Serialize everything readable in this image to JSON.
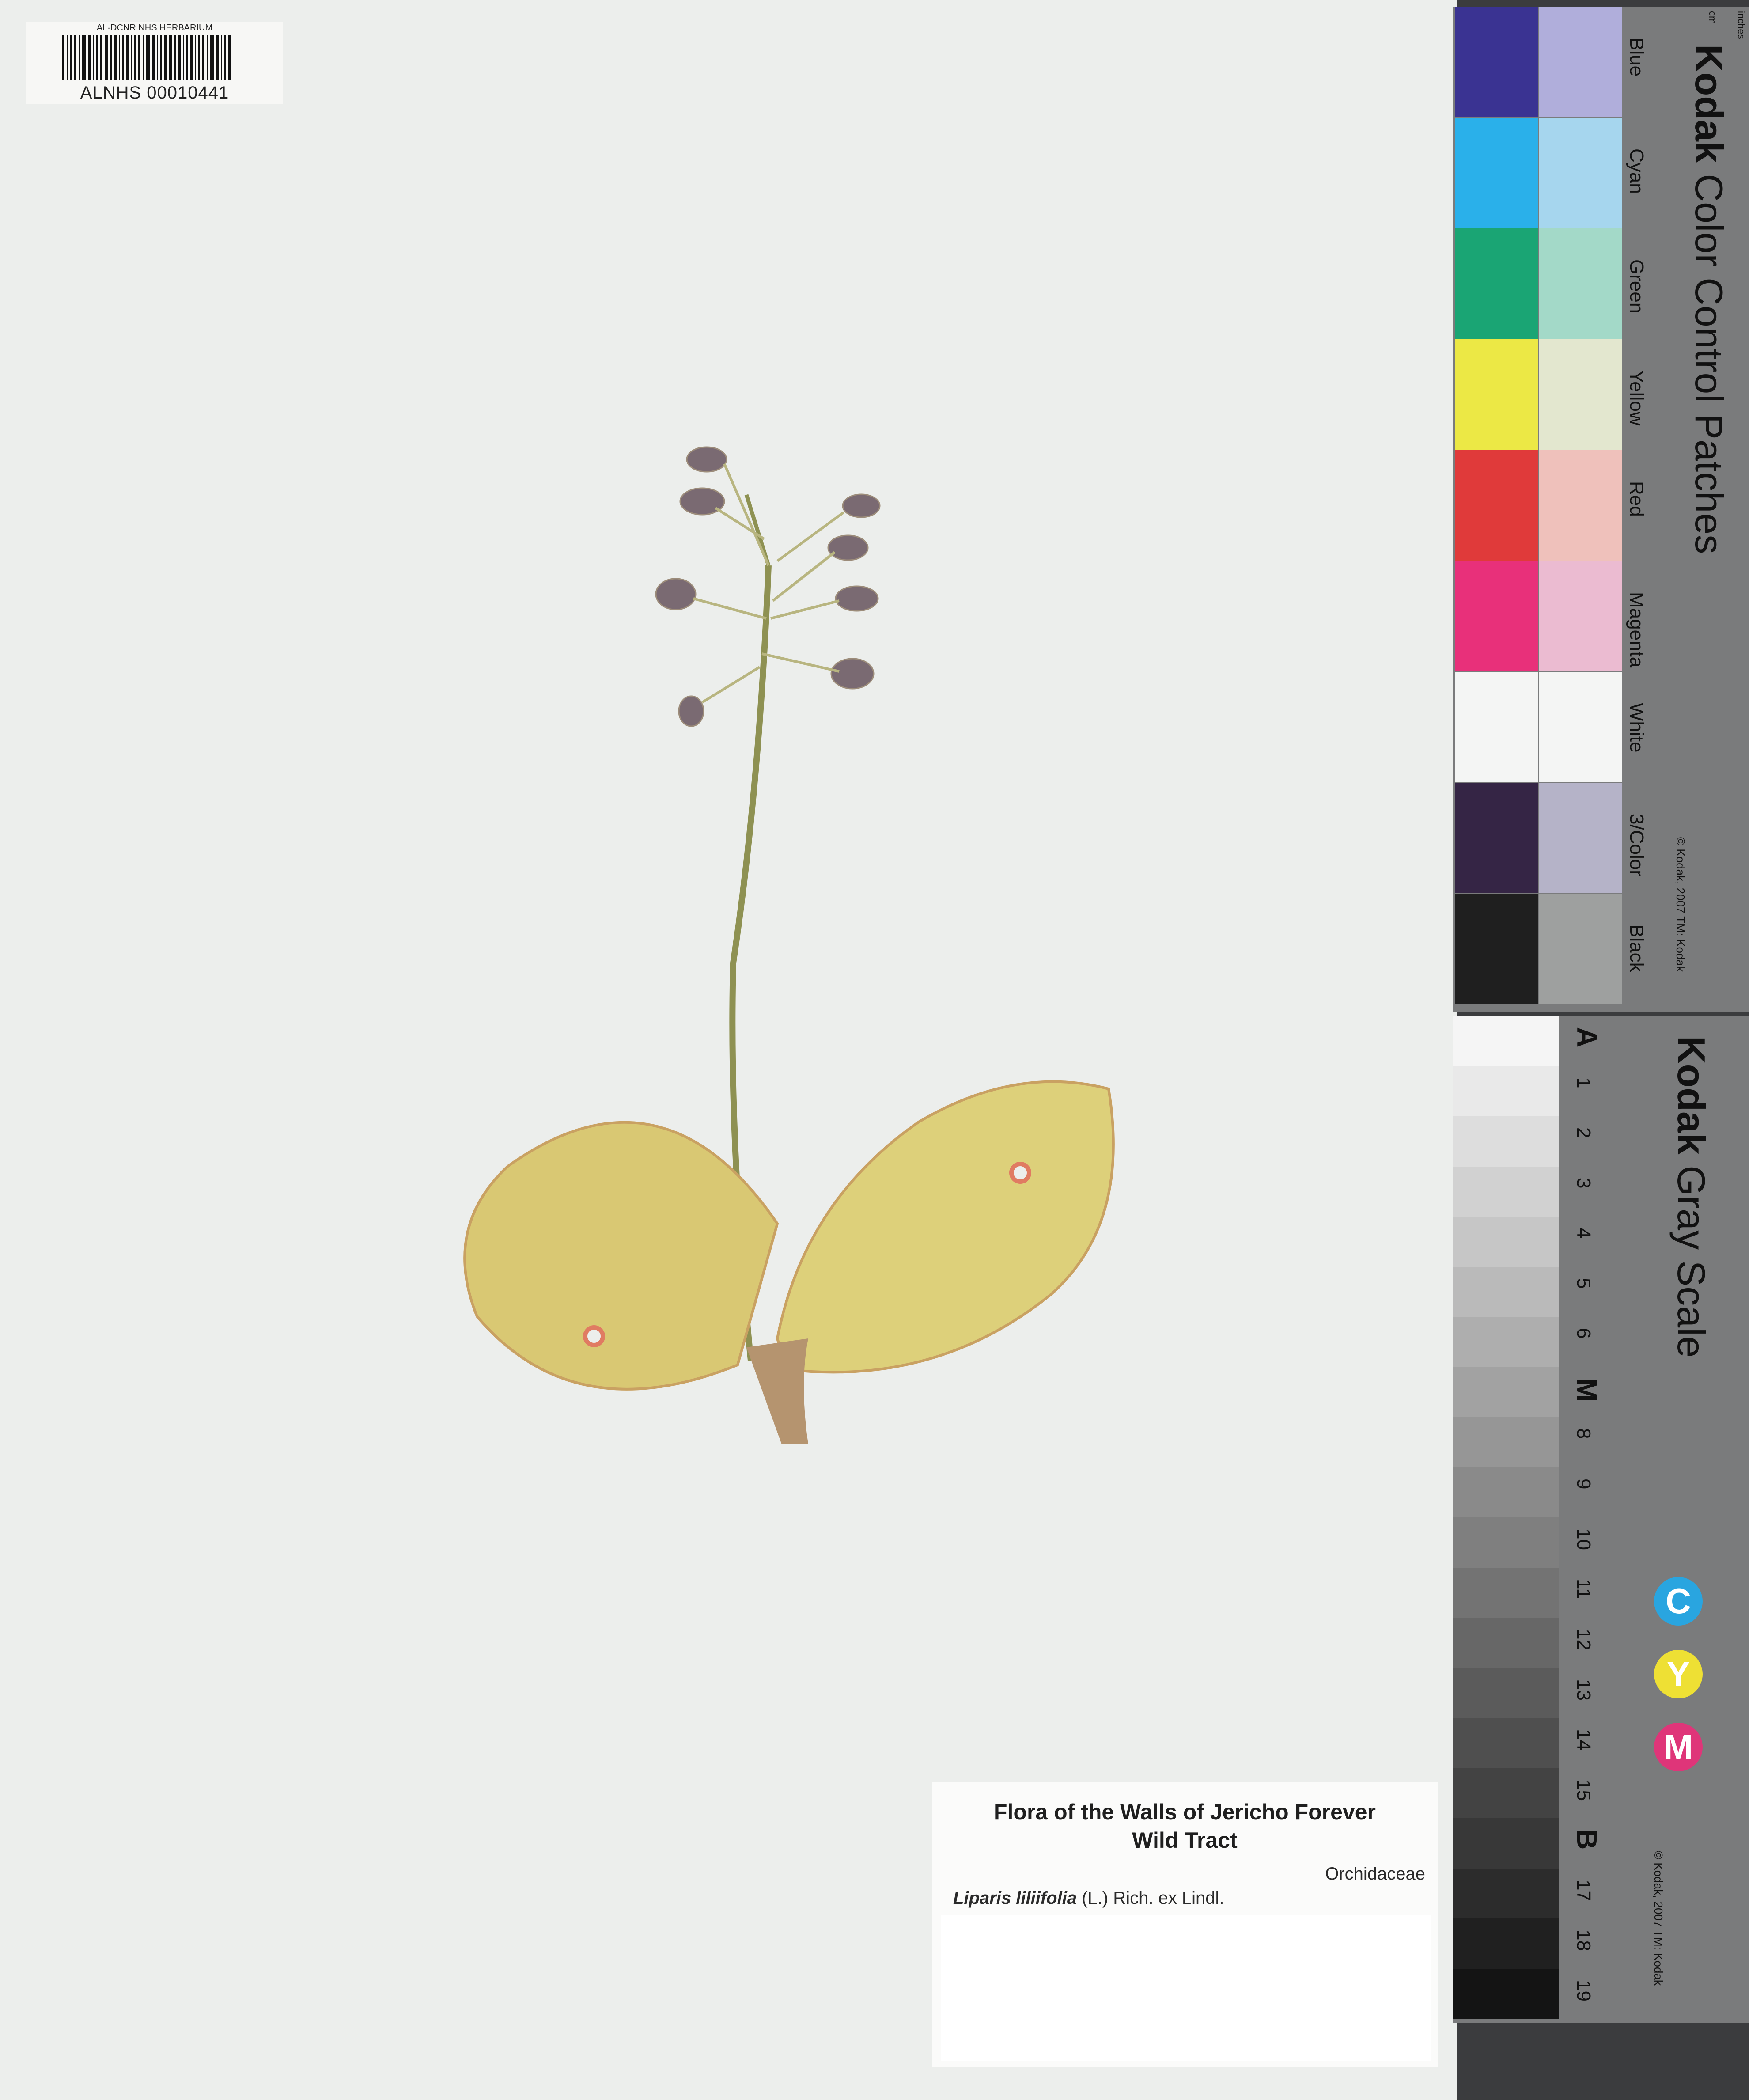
{
  "herbarium_label": {
    "institution": "AL-DCNR NHS HERBARIUM",
    "catalog_number": "ALNHS 00010441"
  },
  "specimen_label": {
    "title_line1": "Flora of the Walls of Jericho Forever",
    "title_line2": "Wild Tract",
    "family": "Orchidaceae",
    "genus_species": "Liparis liliifolia",
    "authority": "(L.) Rich. ex Lindl."
  },
  "color_card": {
    "brand": "Kodak",
    "title": "Color Control Patches",
    "patches": [
      {
        "name": "Blue",
        "color": "#3a3392",
        "light": "#b0aedb"
      },
      {
        "name": "Cyan",
        "color": "#2ab0ea",
        "light": "#a6d6ee"
      },
      {
        "name": "Green",
        "color": "#1aa574",
        "light": "#a3d9c8"
      },
      {
        "name": "Yellow",
        "color": "#ece845",
        "light": "#e3e7cf"
      },
      {
        "name": "Red",
        "color": "#e03a3a",
        "light": "#efc1bb"
      },
      {
        "name": "Magenta",
        "color": "#e8307a",
        "light": "#ebbbd1"
      },
      {
        "name": "White",
        "color": "#f4f5f4",
        "light": "#f4f5f4"
      },
      {
        "name": "3/Color",
        "color": "#352545",
        "light": "#b5b3c8"
      },
      {
        "name": "Black",
        "color": "#1f1f1f",
        "light": "#9ea09f"
      }
    ],
    "copyright": "© Kodak, 2007 TM: Kodak",
    "ruler_units_cm": "cm",
    "ruler_units_in": "inches"
  },
  "gray_card": {
    "brand": "Kodak",
    "title": "Gray Scale",
    "steps": [
      "A",
      "1",
      "2",
      "3",
      "4",
      "5",
      "6",
      "M",
      "8",
      "9",
      "10",
      "11",
      "12",
      "13",
      "14",
      "15",
      "B",
      "17",
      "18",
      "19"
    ],
    "cym": [
      {
        "letter": "C",
        "color": "#29a5e0"
      },
      {
        "letter": "Y",
        "color": "#eee034"
      },
      {
        "letter": "M",
        "color": "#df3579"
      }
    ],
    "copyright": "© Kodak, 2007 TM: Kodak"
  }
}
